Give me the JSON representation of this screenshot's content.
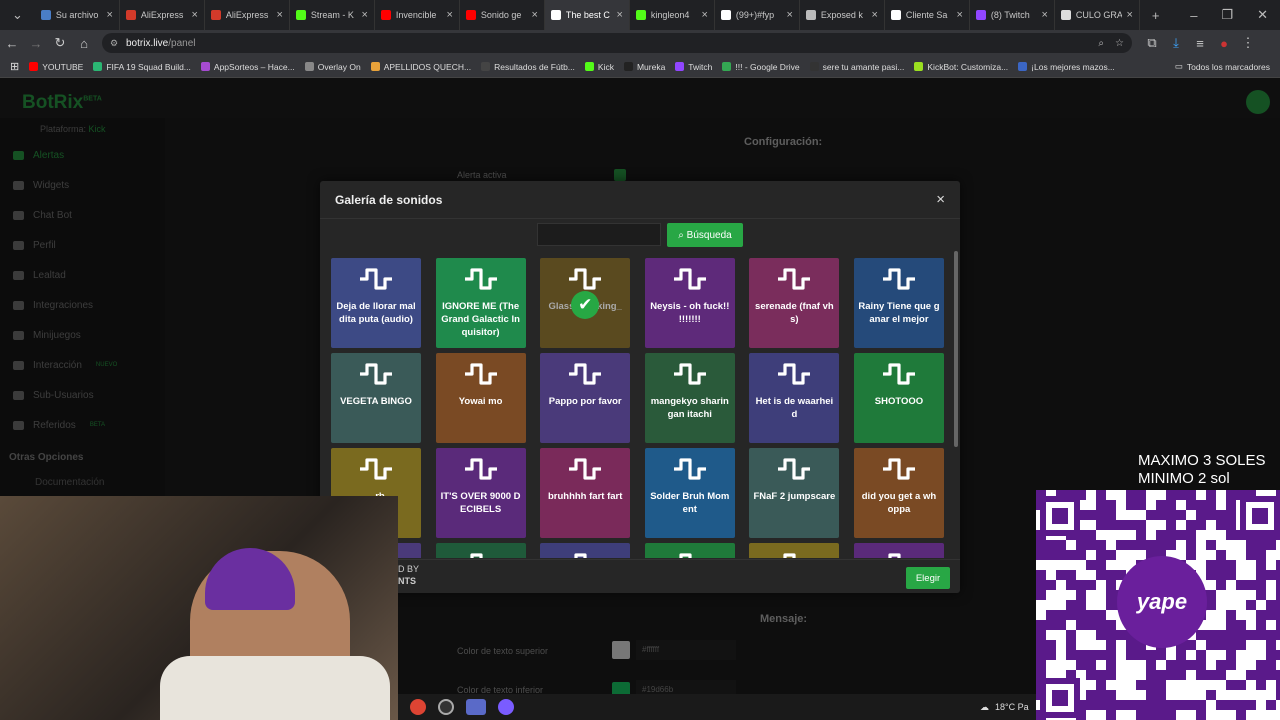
{
  "browser": {
    "tabs": [
      {
        "title": "Su archivo",
        "color": "#4a7ec7"
      },
      {
        "title": "AliExpress",
        "color": "#d23a2a"
      },
      {
        "title": "AliExpress",
        "color": "#d23a2a"
      },
      {
        "title": "Stream - K",
        "color": "#53fc18"
      },
      {
        "title": "Invencible",
        "color": "#ff0000"
      },
      {
        "title": "Sonido ge",
        "color": "#ff0000"
      },
      {
        "title": "The best C",
        "color": "#ffffff"
      },
      {
        "title": "kingleon4",
        "color": "#53fc18"
      },
      {
        "title": "(99+)#fyp",
        "color": "#ffffff"
      },
      {
        "title": "Exposed k",
        "color": "#bbbbbb"
      },
      {
        "title": "Cliente Sa",
        "color": "#ffffff"
      },
      {
        "title": "(8) Twitch",
        "color": "#9146ff"
      },
      {
        "title": "CULO GRA",
        "color": "#dddddd"
      }
    ],
    "active_tab_index": 6,
    "url_host": "botrix.live",
    "url_path": "/panel",
    "bookmarks": [
      {
        "label": "YOUTUBE",
        "color": "#ff0000"
      },
      {
        "label": "FIFA 19 Squad Build...",
        "color": "#2bb673"
      },
      {
        "label": "AppSorteos – Hace...",
        "color": "#a64bd1"
      },
      {
        "label": "Overlay On",
        "color": "#888888"
      },
      {
        "label": "APELLIDOS QUECH...",
        "color": "#e8a23a"
      },
      {
        "label": "Resultados de Fútb...",
        "color": "#444444"
      },
      {
        "label": "Kick",
        "color": "#53fc18"
      },
      {
        "label": "Mureka",
        "color": "#222222"
      },
      {
        "label": "Twitch",
        "color": "#9146ff"
      },
      {
        "label": "!!! - Google Drive",
        "color": "#34a853"
      },
      {
        "label": "sere tu amante pasi...",
        "color": "#333333"
      },
      {
        "label": "KickBot: Customiza...",
        "color": "#9be020"
      },
      {
        "label": "¡Los mejores mazos...",
        "color": "#3b66c4"
      }
    ],
    "all_bookmarks": "Todos los marcadores"
  },
  "app": {
    "logo": "BotRix",
    "logo_badge": "BETA",
    "platform_label": "Plataforma:",
    "platform_value": "Kick",
    "sidebar": [
      {
        "label": "Alertas",
        "badge": ""
      },
      {
        "label": "Widgets",
        "badge": ""
      },
      {
        "label": "Chat Bot",
        "badge": ""
      },
      {
        "label": "Perfil",
        "badge": ""
      },
      {
        "label": "Lealtad",
        "badge": ""
      },
      {
        "label": "Integraciones",
        "badge": ""
      },
      {
        "label": "Minijuegos",
        "badge": ""
      },
      {
        "label": "Interacción",
        "badge": "NUEVO"
      },
      {
        "label": "Sub-Usuarios",
        "badge": ""
      },
      {
        "label": "Referidos",
        "badge": "BETA"
      }
    ],
    "other_options": "Otras Opciones",
    "documentation": "Documentación",
    "config_title": "Configuración:",
    "alert_active": "Alerta activa",
    "message_title": "Mensaje:",
    "top_text_color_label": "Color de texto superior",
    "top_text_color_value": "#ffffff",
    "bottom_text_color_label": "Color de texto inferior",
    "bottom_text_color_value": "#19d66b"
  },
  "modal": {
    "title": "Galería de sonidos",
    "close": "×",
    "search_placeholder": "",
    "search_button": "Búsqueda",
    "select_button": "Elegir",
    "sounds": [
      {
        "name": "Deja de llorar mal dita puta (audio)",
        "color": "#3d4a85",
        "selected": false
      },
      {
        "name": "IGNORE ME (The Grand Galactic In quisitor)",
        "color": "#1f8a4c",
        "selected": false
      },
      {
        "name": "Glass breaking_",
        "color": "#5a4a1f",
        "selected": true
      },
      {
        "name": "Neysis - oh fuck!! !!!!!!!",
        "color": "#5e2a7a",
        "selected": false
      },
      {
        "name": "serenade (fnaf vh s)",
        "color": "#7a2d5c",
        "selected": false
      },
      {
        "name": "Rainy Tiene que ganar el mejor",
        "color": "#254a7a",
        "selected": false
      },
      {
        "name": "VEGETA BINGO",
        "color": "#3a5a58",
        "selected": false
      },
      {
        "name": "Yowai mo",
        "color": "#7a4a24",
        "selected": false
      },
      {
        "name": "Pappo por favor",
        "color": "#4a3a7a",
        "selected": false
      },
      {
        "name": "mangekyo sharin gan itachi",
        "color": "#2a5a3a",
        "selected": false
      },
      {
        "name": "Het is de waarhei d",
        "color": "#3e3e7a",
        "selected": false
      },
      {
        "name": "SHOTOOO",
        "color": "#1f7a3a",
        "selected": false
      },
      {
        "name": "...rb",
        "color": "#7a6a1f",
        "selected": false
      },
      {
        "name": "IT'S OVER 9000 D ECIBELS",
        "color": "#5a2a7a",
        "selected": false
      },
      {
        "name": "bruhhhh fart fart",
        "color": "#7a2a5a",
        "selected": false
      },
      {
        "name": "Solder Bruh Mom ent",
        "color": "#1f5a8a",
        "selected": false
      },
      {
        "name": "FNaF 2 jumpscare",
        "color": "#3a5a58",
        "selected": false
      },
      {
        "name": "did you get a wh oppa",
        "color": "#7a4a24",
        "selected": false
      },
      {
        "name": "",
        "color": "#4a3a7a",
        "selected": false
      },
      {
        "name": "",
        "color": "#1f5a3a",
        "selected": false
      },
      {
        "name": "",
        "color": "#3e3e7a",
        "selected": false
      },
      {
        "name": "",
        "color": "#1f7a3a",
        "selected": false
      },
      {
        "name": "",
        "color": "#7a6a1f",
        "selected": false
      },
      {
        "name": "",
        "color": "#5a2a7a",
        "selected": false
      }
    ]
  },
  "overlay": {
    "watermark_line1": "D BY",
    "watermark_line2": "NTS",
    "donation_max": "MAXIMO 3 SOLES",
    "donation_min": "MINIMO 2 sol",
    "yape_logo": "yape",
    "weather": "18°C Pa"
  }
}
